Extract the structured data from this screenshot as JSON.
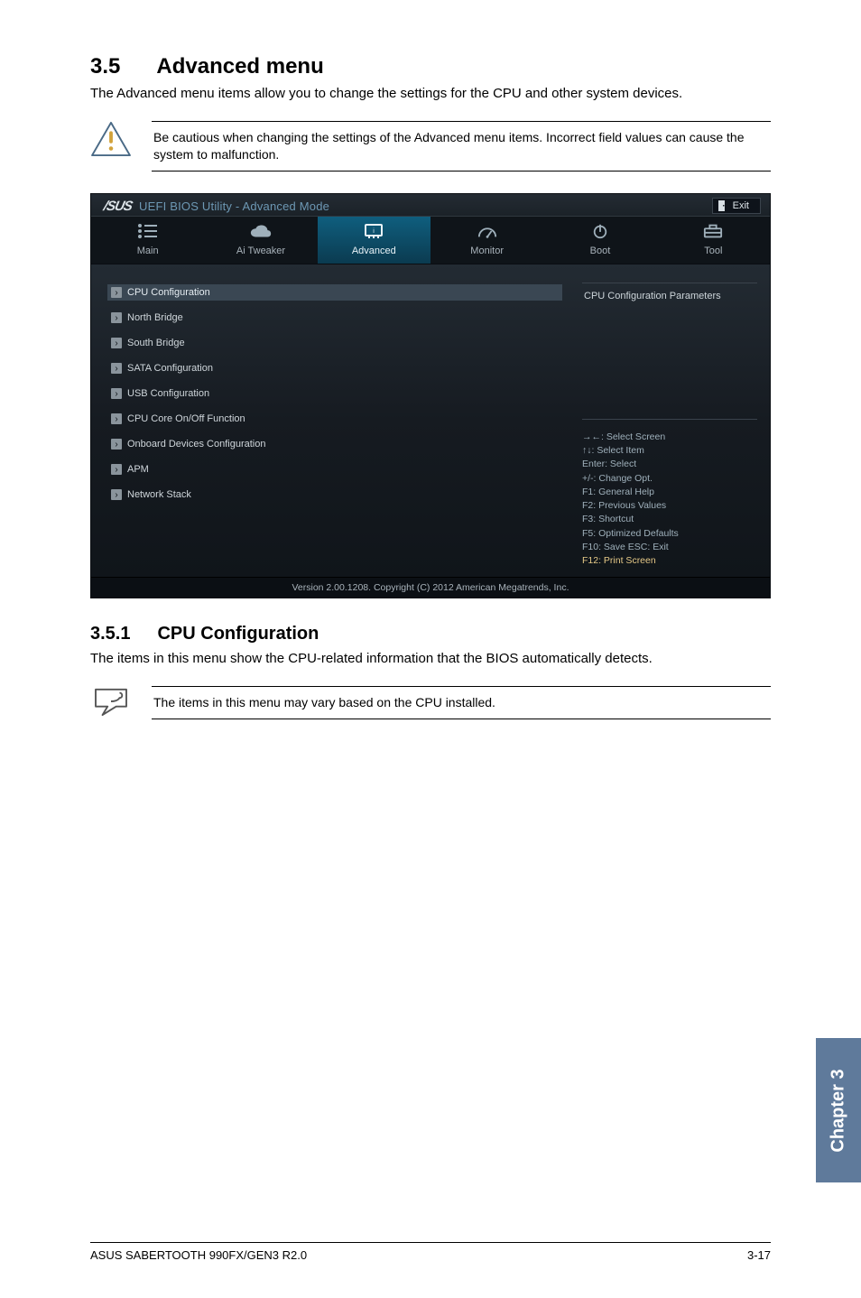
{
  "section": {
    "number": "3.5",
    "title": "Advanced menu",
    "intro": "The Advanced menu items allow you to change the settings for the CPU and other system devices."
  },
  "caution_note": "Be cautious when changing the settings of the Advanced menu items. Incorrect field values can cause the system to malfunction.",
  "bios": {
    "brand": "/SUS",
    "title": "UEFI BIOS Utility - Advanced Mode",
    "exit_label": "Exit",
    "tabs": [
      {
        "label": "Main"
      },
      {
        "label": "Ai  Tweaker"
      },
      {
        "label": "Advanced"
      },
      {
        "label": "Monitor"
      },
      {
        "label": "Boot"
      },
      {
        "label": "Tool"
      }
    ],
    "menu_items": [
      "CPU Configuration",
      "North Bridge",
      "South Bridge",
      "SATA Configuration",
      "USB Configuration",
      "CPU Core On/Off Function",
      "Onboard Devices Configuration",
      "APM",
      "Network Stack"
    ],
    "right_title": "CPU Configuration Parameters",
    "help": [
      "→←:  Select Screen",
      "↑↓:  Select Item",
      "Enter:  Select",
      "+/-:  Change Opt.",
      "F1:  General Help",
      "F2:  Previous Values",
      "F3:  Shortcut",
      "F5:  Optimized Defaults",
      "F10:  Save    ESC:  Exit",
      "F12: Print Screen"
    ],
    "footer": "Version  2.00.1208.   Copyright  (C)  2012  American  Megatrends,  Inc."
  },
  "subsection": {
    "number": "3.5.1",
    "title": "CPU Configuration",
    "intro": "The items in this menu show the CPU-related information that the BIOS automatically detects."
  },
  "info_note": "The items in this menu may vary based on the CPU installed.",
  "chapter_tab": "Chapter 3",
  "footer_left": "ASUS SABERTOOTH 990FX/GEN3 R2.0",
  "footer_right": "3-17"
}
